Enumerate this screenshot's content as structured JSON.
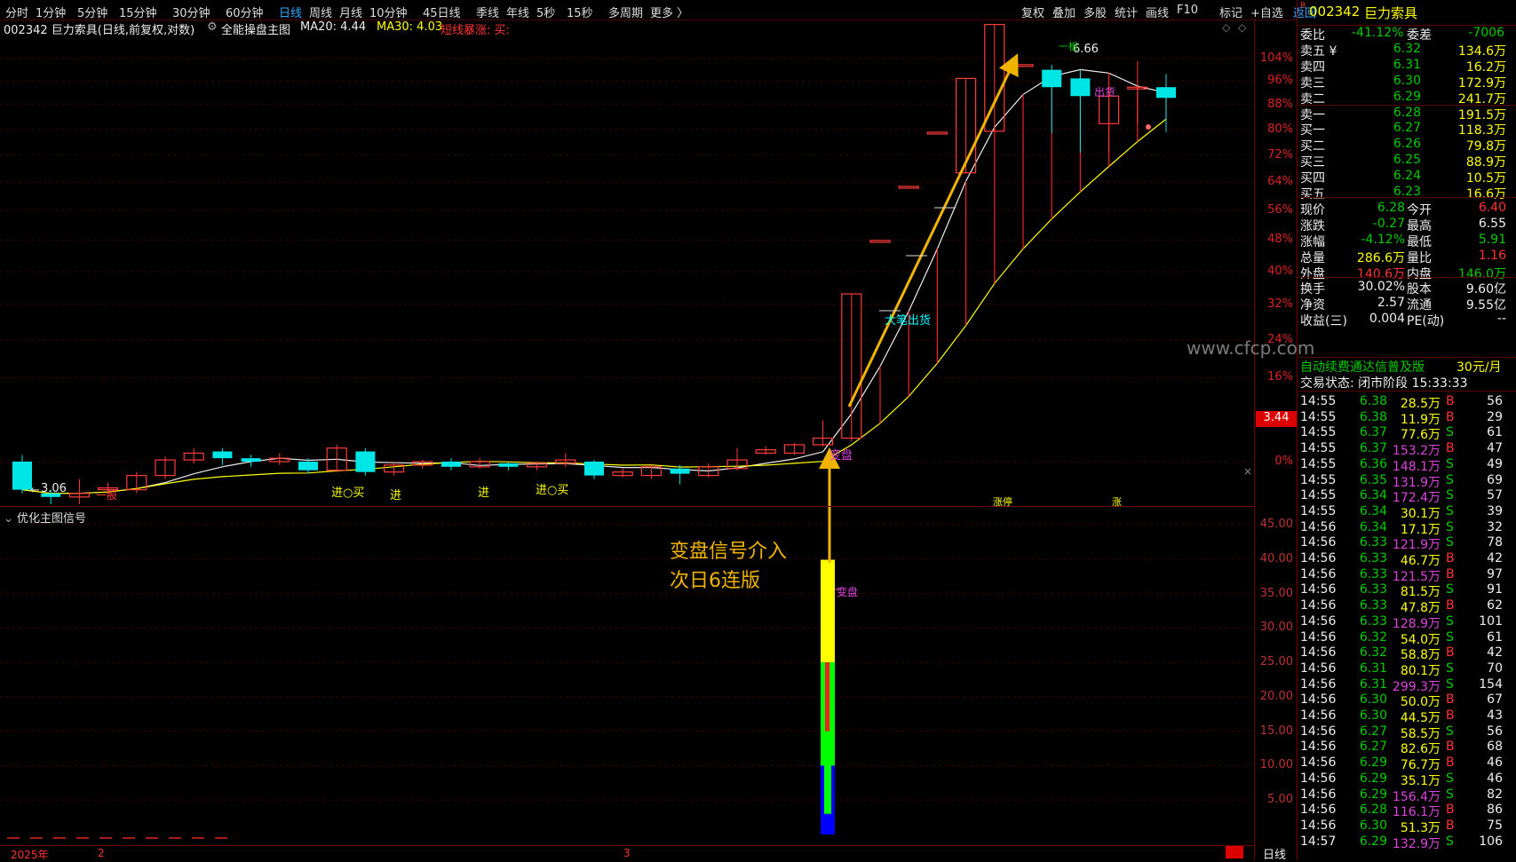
{
  "toolbar": {
    "periods": [
      "分时",
      "1分钟",
      "5分钟",
      "15分钟",
      "30分钟",
      "60分钟",
      "日线",
      "周线",
      "月线",
      "10分钟",
      "45日线",
      "季线",
      "年线",
      "5秒",
      "15秒",
      "多周期",
      "更多 〉"
    ],
    "active_period": "日线",
    "right_tools": [
      "复权",
      "叠加",
      "多股",
      "统计",
      "画线",
      "F10",
      "标记",
      "+自选",
      "返回"
    ]
  },
  "chart": {
    "info_title": "002342 巨力索具(日线,前复权,对数)",
    "indicator": "全能操盘主图",
    "ma20": "MA20: 4.44",
    "ma30": "MA30: 4.03",
    "short_signal": "短线暴涨: 买:",
    "price_axis": [
      "104%",
      "96%",
      "88%",
      "80%",
      "72%",
      "64%",
      "56%",
      "48%",
      "40%",
      "32%",
      "24%",
      "16%",
      "0%"
    ],
    "current_price_tag": "3.44",
    "high_label": "6.66",
    "low_label": "3.06",
    "lower_title": "优化主图信号",
    "lower_axis": [
      "45.00",
      "40.00",
      "35.00",
      "30.00",
      "25.00",
      "20.00",
      "15.00",
      "10.00",
      "5.00"
    ],
    "annotations": {
      "big_sell": "大笔出货",
      "ship": "出货",
      "change_upper": "变盘",
      "change_lower": "变盘",
      "callout_line1": "变盘信号介入",
      "callout_line2": "次日6连版",
      "first_board": "一板",
      "limit_up1": "涨停",
      "limit_up2": "涨",
      "one_stock": "一股"
    },
    "signals": [
      "进○买",
      "进",
      "进",
      "进○买"
    ],
    "bottom_dates": [
      "2025年",
      "2",
      "3"
    ],
    "bottom_period": "日线",
    "watermark": "www.cfcp.com"
  },
  "chart_data": {
    "type": "candlestick",
    "title": "002342 巨力索具(日线,前复权,对数)",
    "y_axis_labels_percent": [
      0,
      16,
      24,
      32,
      40,
      48,
      56,
      64,
      72,
      80,
      88,
      96,
      104
    ],
    "candles": [
      {
        "o": 3.3,
        "c": 3.14,
        "h": 3.34,
        "l": 3.12
      },
      {
        "o": 3.12,
        "c": 3.1,
        "h": 3.14,
        "l": 3.06
      },
      {
        "o": 3.1,
        "c": 3.12,
        "h": 3.2,
        "l": 3.06
      },
      {
        "o": 3.14,
        "c": 3.15,
        "h": 3.18,
        "l": 3.1
      },
      {
        "o": 3.14,
        "c": 3.22,
        "h": 3.24,
        "l": 3.12
      },
      {
        "o": 3.22,
        "c": 3.31,
        "h": 3.33,
        "l": 3.2
      },
      {
        "o": 3.31,
        "c": 3.35,
        "h": 3.38,
        "l": 3.29
      },
      {
        "o": 3.36,
        "c": 3.32,
        "h": 3.38,
        "l": 3.28
      },
      {
        "o": 3.32,
        "c": 3.3,
        "h": 3.34,
        "l": 3.27
      },
      {
        "o": 3.3,
        "c": 3.32,
        "h": 3.35,
        "l": 3.28
      },
      {
        "o": 3.3,
        "c": 3.25,
        "h": 3.32,
        "l": 3.23
      },
      {
        "o": 3.25,
        "c": 3.38,
        "h": 3.4,
        "l": 3.24
      },
      {
        "o": 3.36,
        "c": 3.24,
        "h": 3.38,
        "l": 3.22
      },
      {
        "o": 3.24,
        "c": 3.28,
        "h": 3.3,
        "l": 3.22
      },
      {
        "o": 3.28,
        "c": 3.3,
        "h": 3.31,
        "l": 3.26
      },
      {
        "o": 3.3,
        "c": 3.27,
        "h": 3.32,
        "l": 3.25
      },
      {
        "o": 3.27,
        "c": 3.3,
        "h": 3.32,
        "l": 3.26
      },
      {
        "o": 3.29,
        "c": 3.27,
        "h": 3.3,
        "l": 3.25
      },
      {
        "o": 3.27,
        "c": 3.29,
        "h": 3.3,
        "l": 3.25
      },
      {
        "o": 3.29,
        "c": 3.31,
        "h": 3.35,
        "l": 3.27
      },
      {
        "o": 3.3,
        "c": 3.22,
        "h": 3.31,
        "l": 3.2
      },
      {
        "o": 3.22,
        "c": 3.24,
        "h": 3.26,
        "l": 3.21
      },
      {
        "o": 3.22,
        "c": 3.27,
        "h": 3.28,
        "l": 3.2
      },
      {
        "o": 3.26,
        "c": 3.23,
        "h": 3.28,
        "l": 3.17
      },
      {
        "o": 3.22,
        "c": 3.27,
        "h": 3.29,
        "l": 3.21
      },
      {
        "o": 3.26,
        "c": 3.31,
        "h": 3.38,
        "l": 3.25
      },
      {
        "o": 3.35,
        "c": 3.37,
        "h": 3.39,
        "l": 3.34
      },
      {
        "o": 3.35,
        "c": 3.4,
        "h": 3.41,
        "l": 3.34
      },
      {
        "o": 3.4,
        "c": 3.44,
        "h": 3.55,
        "l": 3.39
      },
      {
        "o": 3.44,
        "c": 4.44,
        "h": 4.44,
        "l": 3.42
      },
      {
        "o": 4.88,
        "c": 4.88,
        "h": 4.88,
        "l": 4.88
      },
      {
        "o": 5.37,
        "c": 5.37,
        "h": 5.37,
        "l": 5.37
      },
      {
        "o": 5.91,
        "c": 5.91,
        "h": 5.91,
        "l": 5.91
      },
      {
        "o": 5.5,
        "c": 6.5,
        "h": 6.5,
        "l": 5.5
      },
      {
        "o": 5.92,
        "c": 7.15,
        "h": 7.15,
        "l": 5.92
      },
      {
        "o": 6.66,
        "c": 6.66,
        "h": 6.66,
        "l": 6.66
      },
      {
        "o": 6.6,
        "c": 6.4,
        "h": 6.66,
        "l": 5.9
      },
      {
        "o": 6.5,
        "c": 6.3,
        "h": 6.6,
        "l": 5.7
      },
      {
        "o": 6.0,
        "c": 6.3,
        "h": 6.4,
        "l": 5.7
      },
      {
        "o": 6.4,
        "c": 6.4,
        "h": 6.7,
        "l": 6.0
      },
      {
        "o": 6.4,
        "c": 6.28,
        "h": 6.55,
        "l": 5.91
      }
    ],
    "ma20": 4.44,
    "ma30": 4.03,
    "lower_indicator": {
      "bar_top": 39.9,
      "yellow_to": 25.0,
      "green_to": 10.0,
      "blue_to": 0,
      "axis_max": 45
    }
  },
  "quote": {
    "code": "002342",
    "name": "巨力索具",
    "weibi_label": "委比",
    "weibi": "-41.12%",
    "weicha_label": "委差",
    "weicha": "-7006",
    "sell": [
      {
        "label": "卖五",
        "price": "6.32",
        "vol": "134.6万"
      },
      {
        "label": "卖四",
        "price": "6.31",
        "vol": "16.2万"
      },
      {
        "label": "卖三",
        "price": "6.30",
        "vol": "172.9万"
      },
      {
        "label": "卖二",
        "price": "6.29",
        "vol": "241.7万"
      },
      {
        "label": "卖一",
        "price": "6.28",
        "vol": "191.5万"
      }
    ],
    "buy": [
      {
        "label": "买一",
        "price": "6.27",
        "vol": "118.3万"
      },
      {
        "label": "买二",
        "price": "6.26",
        "vol": "79.8万"
      },
      {
        "label": "买三",
        "price": "6.25",
        "vol": "88.9万"
      },
      {
        "label": "买四",
        "price": "6.24",
        "vol": "10.5万"
      },
      {
        "label": "买五",
        "price": "6.23",
        "vol": "16.6万"
      }
    ],
    "stats": [
      {
        "l1": "现价",
        "v1": "6.28",
        "c1": "g",
        "l2": "今开",
        "v2": "6.40",
        "c2": "r"
      },
      {
        "l1": "涨跌",
        "v1": "-0.27",
        "c1": "g",
        "l2": "最高",
        "v2": "6.55",
        "c2": "w"
      },
      {
        "l1": "涨幅",
        "v1": "-4.12%",
        "c1": "g",
        "l2": "最低",
        "v2": "5.91",
        "c2": "g"
      },
      {
        "l1": "总量",
        "v1": "286.6万",
        "c1": "y",
        "l2": "量比",
        "v2": "1.16",
        "c2": "r"
      },
      {
        "l1": "外盘",
        "v1": "140.6万",
        "c1": "r",
        "l2": "内盘",
        "v2": "146.0万",
        "c2": "g"
      }
    ],
    "stats2": [
      {
        "l1": "换手",
        "v1": "30.02%",
        "l2": "股本",
        "v2": "9.60亿"
      },
      {
        "l1": "净资",
        "v1": "2.57",
        "l2": "流通",
        "v2": "9.55亿"
      },
      {
        "l1": "收益(三)",
        "v1": "0.004",
        "l2": "PE(动)",
        "v2": "--"
      }
    ],
    "ad": "自动续费通达信普及版",
    "ad_price": "30元/月",
    "status": "交易状态: 闭市阶段 15:33:33",
    "ticks": [
      {
        "t": "14:55",
        "p": "6.38",
        "v": "28.5万",
        "s": "B",
        "n": "56"
      },
      {
        "t": "14:55",
        "p": "6.38",
        "v": "11.9万",
        "s": "B",
        "n": "29"
      },
      {
        "t": "14:55",
        "p": "6.37",
        "v": "77.6万",
        "s": "S",
        "n": "61"
      },
      {
        "t": "14:55",
        "p": "6.37",
        "v": "153.2万",
        "s": "B",
        "n": "47"
      },
      {
        "t": "14:55",
        "p": "6.36",
        "v": "148.1万",
        "s": "S",
        "n": "49"
      },
      {
        "t": "14:55",
        "p": "6.35",
        "v": "131.9万",
        "s": "S",
        "n": "69"
      },
      {
        "t": "14:55",
        "p": "6.34",
        "v": "172.4万",
        "s": "S",
        "n": "57"
      },
      {
        "t": "14:55",
        "p": "6.34",
        "v": "30.1万",
        "s": "S",
        "n": "39"
      },
      {
        "t": "14:56",
        "p": "6.34",
        "v": "17.1万",
        "s": "S",
        "n": "32"
      },
      {
        "t": "14:56",
        "p": "6.33",
        "v": "121.9万",
        "s": "S",
        "n": "78"
      },
      {
        "t": "14:56",
        "p": "6.33",
        "v": "46.7万",
        "s": "B",
        "n": "42"
      },
      {
        "t": "14:56",
        "p": "6.33",
        "v": "121.5万",
        "s": "B",
        "n": "97"
      },
      {
        "t": "14:56",
        "p": "6.33",
        "v": "81.5万",
        "s": "S",
        "n": "91"
      },
      {
        "t": "14:56",
        "p": "6.33",
        "v": "47.8万",
        "s": "B",
        "n": "62"
      },
      {
        "t": "14:56",
        "p": "6.33",
        "v": "128.9万",
        "s": "S",
        "n": "101"
      },
      {
        "t": "14:56",
        "p": "6.32",
        "v": "54.0万",
        "s": "S",
        "n": "61"
      },
      {
        "t": "14:56",
        "p": "6.32",
        "v": "58.8万",
        "s": "B",
        "n": "42"
      },
      {
        "t": "14:56",
        "p": "6.31",
        "v": "80.1万",
        "s": "S",
        "n": "70"
      },
      {
        "t": "14:56",
        "p": "6.31",
        "v": "299.3万",
        "s": "S",
        "n": "154"
      },
      {
        "t": "14:56",
        "p": "6.30",
        "v": "50.0万",
        "s": "B",
        "n": "67"
      },
      {
        "t": "14:56",
        "p": "6.30",
        "v": "44.5万",
        "s": "B",
        "n": "43"
      },
      {
        "t": "14:56",
        "p": "6.27",
        "v": "58.5万",
        "s": "S",
        "n": "56"
      },
      {
        "t": "14:56",
        "p": "6.27",
        "v": "82.6万",
        "s": "B",
        "n": "68"
      },
      {
        "t": "14:56",
        "p": "6.29",
        "v": "76.7万",
        "s": "B",
        "n": "46"
      },
      {
        "t": "14:56",
        "p": "6.29",
        "v": "35.1万",
        "s": "S",
        "n": "46"
      },
      {
        "t": "14:56",
        "p": "6.29",
        "v": "156.4万",
        "s": "S",
        "n": "82"
      },
      {
        "t": "14:56",
        "p": "6.28",
        "v": "116.1万",
        "s": "B",
        "n": "86"
      },
      {
        "t": "14:56",
        "p": "6.30",
        "v": "51.3万",
        "s": "B",
        "n": "75"
      },
      {
        "t": "14:57",
        "p": "6.29",
        "v": "132.9万",
        "s": "S",
        "n": "106"
      }
    ]
  }
}
